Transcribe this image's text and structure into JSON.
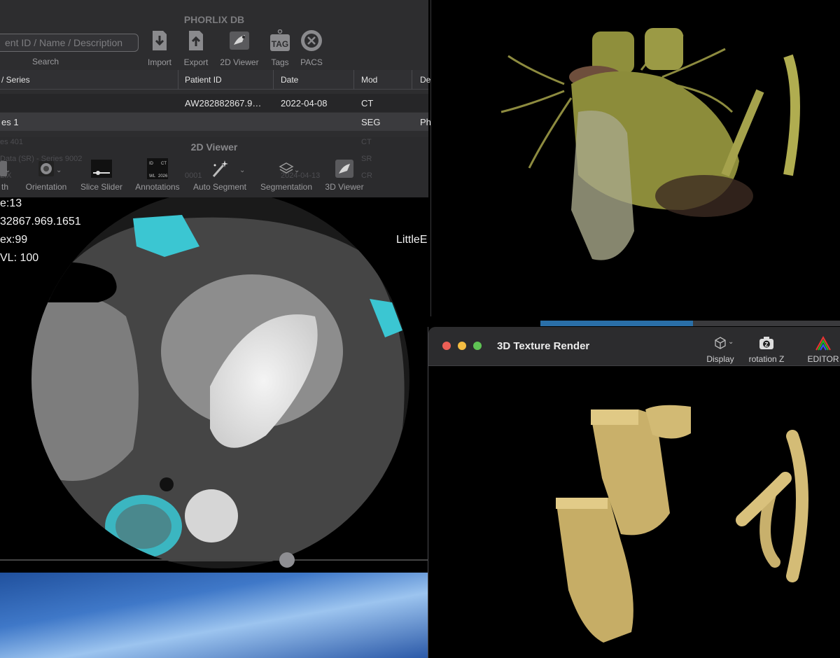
{
  "db_window": {
    "title": "PHORLIX DB",
    "search": {
      "placeholder": "ent ID / Name / Description",
      "label": "Search"
    },
    "toolbar": {
      "import": "Import",
      "export": "Export",
      "viewer_2d": "2D Viewer",
      "tags": "Tags",
      "tags_icon_text": "TAG",
      "pacs": "PACS"
    },
    "columns": {
      "series": "/ Series",
      "patient_id": "Patient ID",
      "date": "Date",
      "mod": "Mod",
      "desc": "De"
    },
    "rows": [
      {
        "series": "",
        "patient_id": "AW282882867.9…",
        "date": "2022-04-08",
        "mod": "CT",
        "desc": ""
      },
      {
        "series": "es 1",
        "patient_id": "",
        "date": "",
        "mod": "SEG",
        "desc": "Ph"
      }
    ]
  },
  "viewer_2d": {
    "title": "2D Viewer",
    "toolbar": {
      "width_partial": "th",
      "orientation": "Orientation",
      "slice_slider": "Slice Slider",
      "annotations": "Annotations",
      "auto_segment": "Auto Segment",
      "segmentation": "Segmentation",
      "viewer_3d": "3D Viewer"
    },
    "annotation_icon_text": {
      "id": "ID",
      "ct": "CT",
      "wl": "WL",
      "year": "2026"
    },
    "ghost_rows": {
      "r1": "es 401",
      "r1_mod": "CT",
      "r2": "Data (SR) - Series 9002",
      "r2_mod": "SR",
      "r3": "LIX",
      "r3_id": "0001",
      "r3_date": "2024-04-13",
      "r3_mod": "CR"
    },
    "overlay": {
      "slice": "e:13",
      "uid": "32867.969.1651",
      "index": "ex:99",
      "wl": "VL: 100",
      "patient_name": "LittleE"
    },
    "slice_position": 0.67
  },
  "volume_render": {
    "progress": 0.51
  },
  "texture_window": {
    "title": "3D Texture Render",
    "display": "Display",
    "rotation": "rotation Z",
    "rotation_icon_text": "Z",
    "editor": "EDITOR"
  }
}
